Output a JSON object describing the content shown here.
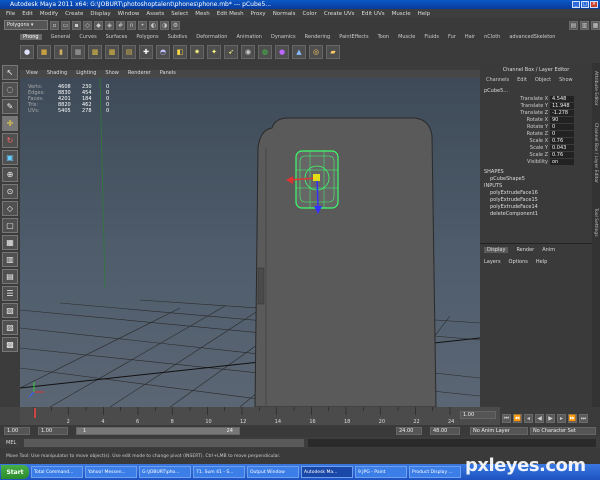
{
  "window": {
    "title": "Autodesk Maya 2011 x64: G:\\JOBURT\\photoshoptalent\\phones\\phone.mb* --- pCube5..."
  },
  "menubar": [
    "File",
    "Edit",
    "Modify",
    "Create",
    "Display",
    "Window",
    "Assets",
    "Select",
    "Mesh",
    "Edit Mesh",
    "Proxy",
    "Normals",
    "Color",
    "Create UVs",
    "Edit UVs",
    "Muscle",
    "Help"
  ],
  "status_line": {
    "mode": "Polygons"
  },
  "shelf_tabs": [
    "Phong",
    "General",
    "Curves",
    "Surfaces",
    "Polygons",
    "Subdivs",
    "Deformation",
    "Animation",
    "Dynamics",
    "Rendering",
    "PaintEffects",
    "Toon",
    "Muscle",
    "Fluids",
    "Fur",
    "Hair",
    "nCloth",
    "advancedSkeleton"
  ],
  "viewport": {
    "menu": [
      "View",
      "Shading",
      "Lighting",
      "Show",
      "Renderer",
      "Panels"
    ],
    "hud": [
      {
        "label": "Verts:",
        "v1": "4608",
        "v2": "230",
        "v3": "0"
      },
      {
        "label": "Edges:",
        "v1": "8830",
        "v2": "454",
        "v3": "0"
      },
      {
        "label": "Faces:",
        "v1": "4201",
        "v2": "184",
        "v3": "0"
      },
      {
        "label": "Tris:",
        "v1": "8820",
        "v2": "462",
        "v3": "0"
      },
      {
        "label": "UVs:",
        "v1": "5405",
        "v2": "278",
        "v3": "0"
      }
    ]
  },
  "channel_box": {
    "title": "Channel Box / Layer Editor",
    "menu": [
      "Channels",
      "Edit",
      "Object",
      "Show"
    ],
    "object": "pCube5...",
    "attributes": [
      {
        "name": "Translate X",
        "value": "4.548"
      },
      {
        "name": "Translate Y",
        "value": "11.948"
      },
      {
        "name": "Translate Z",
        "value": "-1.278"
      },
      {
        "name": "Rotate X",
        "value": "90"
      },
      {
        "name": "Rotate Y",
        "value": "0"
      },
      {
        "name": "Rotate Z",
        "value": "0"
      },
      {
        "name": "Scale X",
        "value": "0.76"
      },
      {
        "name": "Scale Y",
        "value": "0.043"
      },
      {
        "name": "Scale Z",
        "value": "0.76"
      },
      {
        "name": "Visibility",
        "value": "on"
      }
    ],
    "shapes_header": "SHAPES",
    "shape": "pCubeShape5",
    "inputs_header": "INPUTS",
    "inputs": [
      "polyExtrudeFace16",
      "polyExtrudeFace15",
      "polyExtrudeFace14",
      "deleteComponent1"
    ]
  },
  "layer_editor": {
    "tabs": [
      "Display",
      "Render",
      "Anim"
    ],
    "menu": [
      "Layers",
      "Options",
      "Help"
    ]
  },
  "attr_side_tabs": [
    "Attribute Editor",
    "Channel Box / Layer Editor",
    "Tool Settings"
  ],
  "time_slider": {
    "ticks": [
      "2",
      "4",
      "6",
      "8",
      "10",
      "12",
      "14",
      "16",
      "18",
      "20",
      "22",
      "24"
    ],
    "current": "1.00"
  },
  "range_slider": {
    "start": "1.00",
    "start2": "1.00",
    "range_val": "1",
    "range_end": "24",
    "end": "24.00",
    "end2": "48.00",
    "anim_layer": "No Anim Layer",
    "char_set": "No Character Set"
  },
  "command_line": {
    "label": "MEL"
  },
  "help_line": "Move Tool: Use manipulator to move object(s). Use edit mode to change pivot (INSERT). Ctrl+LMB to move perpendicular.",
  "taskbar": {
    "start": "Start",
    "tasks": [
      "Total Command...",
      "Yahoo! Messen...",
      "G:\\JOBURT\\pho...",
      "71. Sum 41 - S...",
      "Output Window",
      "Autodesk Ma...",
      "9.JPG - Paint",
      "Product Display ..."
    ]
  },
  "watermark": "pxleyes.com"
}
